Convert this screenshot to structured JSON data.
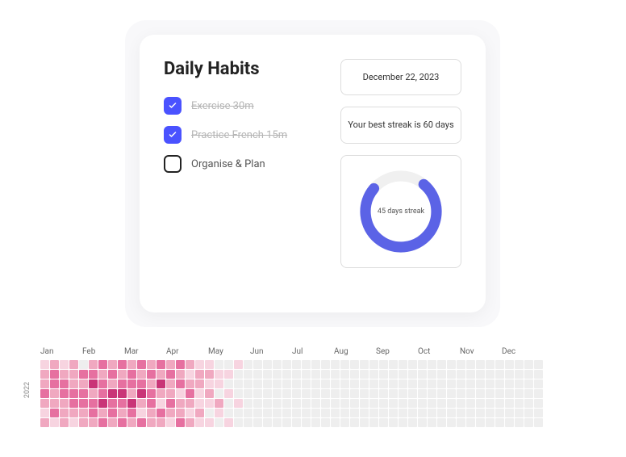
{
  "title": "Daily Habits",
  "date_box": "December 22, 2023",
  "streak_box": "Your best streak is 60 days",
  "ring": {
    "label": "45 days streak",
    "percent": 75
  },
  "habits": [
    {
      "label": "Exercise 30m",
      "done": true
    },
    {
      "label": "Practice French 15m",
      "done": true
    },
    {
      "label": "Organise & Plan",
      "done": false
    }
  ],
  "heatmap": {
    "year": "2022",
    "months": [
      "Jan",
      "Feb",
      "Mar",
      "Apr",
      "May",
      "Jun",
      "Jul",
      "Aug",
      "Sep",
      "Oct",
      "Nov",
      "Dec"
    ],
    "colors": {
      "0": "#eeeeee",
      "1": "#f7d4e0",
      "2": "#f0a8c0",
      "3": "#e670a0",
      "4": "#c93577"
    },
    "weeks": [
      [
        1,
        2,
        2,
        3,
        2,
        1,
        2
      ],
      [
        2,
        3,
        3,
        2,
        2,
        3,
        1
      ],
      [
        1,
        2,
        3,
        3,
        2,
        2,
        2
      ],
      [
        2,
        2,
        2,
        3,
        3,
        2,
        1
      ],
      [
        0,
        3,
        2,
        3,
        3,
        2,
        2
      ],
      [
        2,
        3,
        4,
        2,
        3,
        3,
        2
      ],
      [
        3,
        2,
        3,
        3,
        4,
        2,
        3
      ],
      [
        2,
        3,
        2,
        4,
        3,
        3,
        2
      ],
      [
        3,
        2,
        3,
        4,
        3,
        2,
        3
      ],
      [
        2,
        3,
        3,
        2,
        4,
        3,
        2
      ],
      [
        3,
        2,
        3,
        4,
        2,
        1,
        3
      ],
      [
        2,
        3,
        2,
        3,
        3,
        2,
        2
      ],
      [
        3,
        2,
        4,
        2,
        1,
        3,
        2
      ],
      [
        2,
        3,
        2,
        2,
        3,
        2,
        1
      ],
      [
        3,
        2,
        3,
        1,
        2,
        2,
        3
      ],
      [
        2,
        1,
        2,
        3,
        2,
        1,
        2
      ],
      [
        1,
        2,
        2,
        1,
        1,
        2,
        1
      ],
      [
        1,
        2,
        1,
        2,
        1,
        0,
        1
      ],
      [
        0,
        1,
        1,
        0,
        2,
        1,
        0
      ],
      [
        0,
        1,
        0,
        1,
        0,
        0,
        1
      ],
      [
        1,
        0,
        0,
        0,
        1,
        0,
        0
      ],
      [
        0,
        0,
        0,
        0,
        0,
        0,
        0
      ],
      [
        0,
        0,
        0,
        0,
        0,
        0,
        0
      ],
      [
        0,
        0,
        0,
        0,
        0,
        0,
        0
      ],
      [
        0,
        0,
        0,
        0,
        0,
        0,
        0
      ],
      [
        0,
        0,
        0,
        0,
        0,
        0,
        0
      ],
      [
        0,
        0,
        0,
        0,
        0,
        0,
        0
      ],
      [
        0,
        0,
        0,
        0,
        0,
        0,
        0
      ],
      [
        0,
        0,
        0,
        0,
        0,
        0,
        0
      ],
      [
        0,
        0,
        0,
        0,
        0,
        0,
        0
      ],
      [
        0,
        0,
        0,
        0,
        0,
        0,
        0
      ],
      [
        0,
        0,
        0,
        0,
        0,
        0,
        0
      ],
      [
        0,
        0,
        0,
        0,
        0,
        0,
        0
      ],
      [
        0,
        0,
        0,
        0,
        0,
        0,
        0
      ],
      [
        0,
        0,
        0,
        0,
        0,
        0,
        0
      ],
      [
        0,
        0,
        0,
        0,
        0,
        0,
        0
      ],
      [
        0,
        0,
        0,
        0,
        0,
        0,
        0
      ],
      [
        0,
        0,
        0,
        0,
        0,
        0,
        0
      ],
      [
        0,
        0,
        0,
        0,
        0,
        0,
        0
      ],
      [
        0,
        0,
        0,
        0,
        0,
        0,
        0
      ],
      [
        0,
        0,
        0,
        0,
        0,
        0,
        0
      ],
      [
        0,
        0,
        0,
        0,
        0,
        0,
        0
      ],
      [
        0,
        0,
        0,
        0,
        0,
        0,
        0
      ],
      [
        0,
        0,
        0,
        0,
        0,
        0,
        0
      ],
      [
        0,
        0,
        0,
        0,
        0,
        0,
        0
      ],
      [
        0,
        0,
        0,
        0,
        0,
        0,
        0
      ],
      [
        0,
        0,
        0,
        0,
        0,
        0,
        0
      ],
      [
        0,
        0,
        0,
        0,
        0,
        0,
        0
      ],
      [
        0,
        0,
        0,
        0,
        0,
        0,
        0
      ],
      [
        0,
        0,
        0,
        0,
        0,
        0,
        0
      ],
      [
        0,
        0,
        0,
        0,
        0,
        0,
        0
      ],
      [
        0,
        0,
        0,
        0,
        0,
        0,
        0
      ]
    ]
  }
}
